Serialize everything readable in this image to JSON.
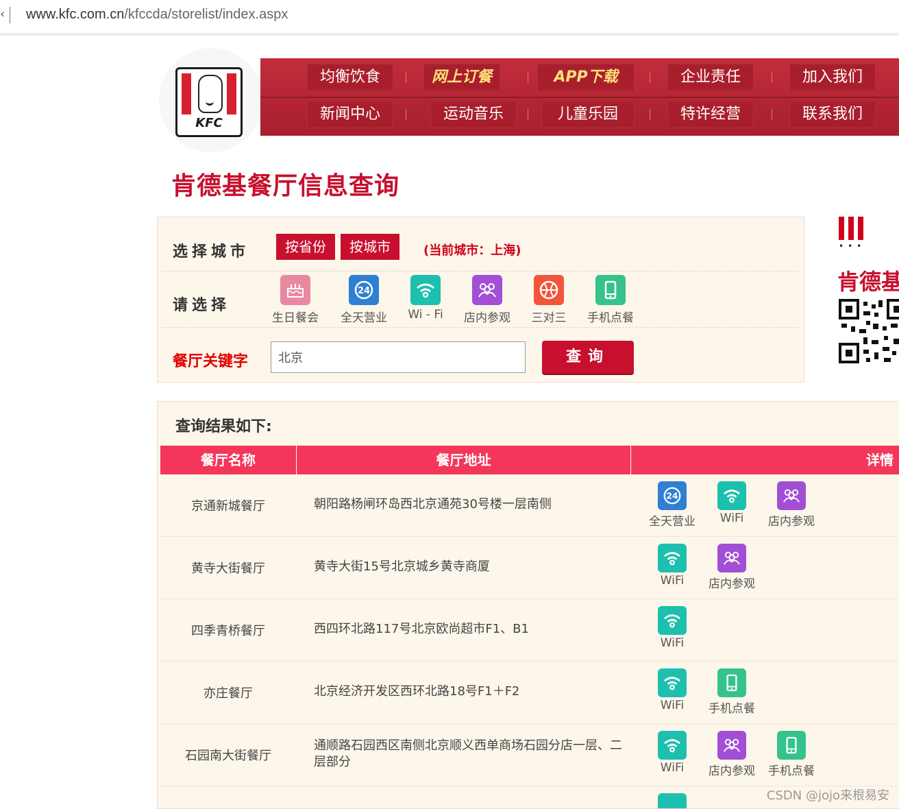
{
  "browser": {
    "url_host": "www.kfc.com.cn",
    "url_path": "/kfccda/storelist/index.aspx"
  },
  "nav": {
    "row1": [
      "均衡饮食",
      "网上订餐",
      "APP下载",
      "企业责任",
      "加入我们"
    ],
    "row2": [
      "新闻中心",
      "运动音乐",
      "儿童乐园",
      "特许经营",
      "联系我们"
    ]
  },
  "logo_text": "KFC",
  "page_title": "肯德基餐厅信息查询",
  "search": {
    "city_label": "选择城市",
    "by_province": "按省份",
    "by_city": "按城市",
    "current_city": "(当前城市：上海)",
    "select_label": "请选择",
    "features": [
      {
        "label": "生日餐会",
        "icon": "birthday-cake-icon",
        "color": "#e889a1"
      },
      {
        "label": "全天营业",
        "icon": "24h-icon",
        "color": "#2f7fd3"
      },
      {
        "label": "Wi - Fi",
        "icon": "wifi-icon",
        "color": "#1dbfae"
      },
      {
        "label": "店内参观",
        "icon": "group-visit-icon",
        "color": "#a24fd6"
      },
      {
        "label": "三对三",
        "icon": "basketball-icon",
        "color": "#f2553c"
      },
      {
        "label": "手机点餐",
        "icon": "mobile-order-icon",
        "color": "#35c28d"
      }
    ],
    "keyword_label": "餐厅关键字",
    "keyword_value": "北京",
    "search_button": "查询"
  },
  "promo": {
    "text": "肯德基"
  },
  "results": {
    "title": "查询结果如下:",
    "columns": [
      "餐厅名称",
      "餐厅地址",
      "详情"
    ],
    "rows": [
      {
        "name": "京通新城餐厅",
        "address": "朝阳路杨闸环岛西北京通苑30号楼一层南侧",
        "tags": [
          "全天营业",
          "WiFi",
          "店内参观"
        ]
      },
      {
        "name": "黄寺大街餐厅",
        "address": "黄寺大街15号北京城乡黄寺商厦",
        "tags": [
          "WiFi",
          "店内参观"
        ]
      },
      {
        "name": "四季青桥餐厅",
        "address": "西四环北路117号北京欧尚超市F1、B1",
        "tags": [
          "WiFi"
        ]
      },
      {
        "name": "亦庄餐厅",
        "address": "北京经济开发区西环北路18号F1＋F2",
        "tags": [
          "WiFi",
          "手机点餐"
        ]
      },
      {
        "name": "石园南大街餐厅",
        "address": "通顺路石园西区南侧北京顺义西单商场石园分店一层、二层部分",
        "tags": [
          "WiFi",
          "店内参观",
          "手机点餐"
        ]
      }
    ]
  },
  "watermark": "CSDN @jojo来根易安"
}
